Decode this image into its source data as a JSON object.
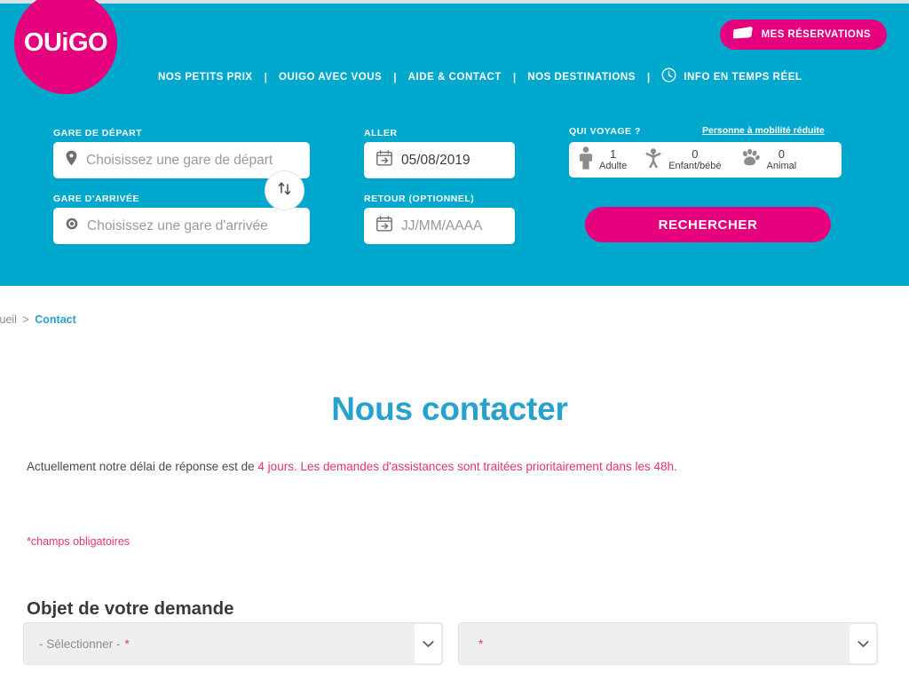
{
  "brand": {
    "logo_text": "OUiGO",
    "colors": {
      "teal": "#00a8ce",
      "pink": "#e5007d",
      "title_blue": "#27a2cf",
      "notice_pink": "#e8336d"
    }
  },
  "header": {
    "reservations_button": "MES RÉSERVATIONS",
    "reservations_icon": "ticket-icon",
    "nav": [
      {
        "label": "NOS PETITS PRIX"
      },
      {
        "label": "OUIGO AVEC VOUS"
      },
      {
        "label": "AIDE & CONTACT"
      },
      {
        "label": "NOS DESTINATIONS"
      },
      {
        "label": "INFO EN TEMPS RÉEL",
        "icon": "clock-icon"
      }
    ],
    "nav_separator": "|"
  },
  "search": {
    "depart": {
      "label": "GARE DE DÉPART",
      "placeholder": "Choisissez une gare de départ",
      "value": "",
      "icon": "map-pin-icon"
    },
    "arrivee": {
      "label": "GARE D'ARRIVÉE",
      "placeholder": "Choisissez une gare d'arrivée",
      "value": "",
      "icon": "target-circle-icon"
    },
    "swap_icon": "swap-arrows-icon",
    "aller": {
      "label": "ALLER",
      "value": "05/08/2019",
      "icon": "calendar-depart-icon"
    },
    "retour": {
      "label": "RETOUR (optionnel)",
      "placeholder": "JJ/MM/AAAA",
      "value": "",
      "icon": "calendar-return-icon"
    },
    "passengers": {
      "label": "QUI VOYAGE ?",
      "pmr_link": "Personne à mobilité réduite",
      "items": [
        {
          "count": "1",
          "name": "Adulte",
          "icon": "adult-icon"
        },
        {
          "count": "0",
          "name": "Enfant/bébé",
          "icon": "child-icon"
        },
        {
          "count": "0",
          "name": "Animal",
          "icon": "paw-icon"
        }
      ]
    },
    "submit_button": "RECHERCHER"
  },
  "content": {
    "breadcrumb": {
      "home": "ccueil",
      "separator": ">",
      "current": "Contact"
    },
    "page_title": "Nous contacter",
    "notice": {
      "plain": "Actuellement notre délai de réponse est de ",
      "highlight": "4 jours. Les demandes d'assistances sont traitées prioritairement dans les 48h."
    },
    "required_note": "*champs obligatoires",
    "section_title": "Objet de votre demande",
    "select_objet": {
      "value": "- Sélectionner -",
      "required_mark": "*",
      "arrow_icon": "chevron-down-icon"
    },
    "select_sousobjet": {
      "value": "",
      "required_mark": "*",
      "arrow_icon": "chevron-down-icon"
    }
  }
}
